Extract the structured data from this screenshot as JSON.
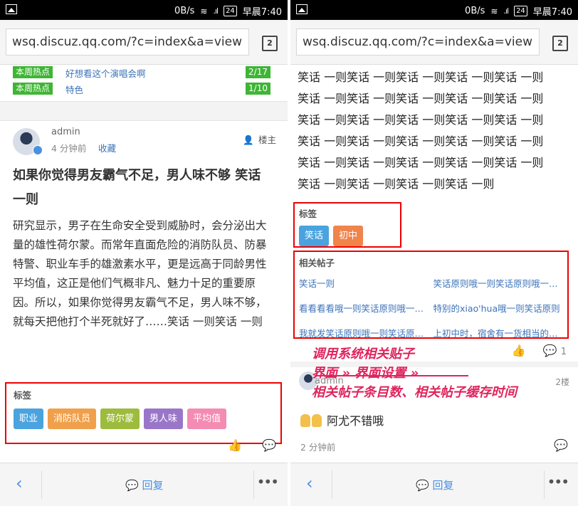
{
  "status": {
    "speed": "0B/s",
    "battery": "24",
    "time": "早晨7:40"
  },
  "browser": {
    "url": "wsq.discuz.qq.com/?c=index&a=view",
    "tab_count": "2"
  },
  "left": {
    "hot_items": [
      {
        "badge": "本周热点",
        "title": "好想看这个演唱会啊",
        "count": "2/17"
      },
      {
        "badge": "本周热点",
        "title": "特色",
        "count": "1/10"
      }
    ],
    "post": {
      "author": "admin",
      "time": "4 分钟前",
      "favorite": "收藏",
      "floor": "楼主",
      "title": "如果你觉得男友霸气不足，男人味不够 笑话 一则",
      "body": "研究显示，男子在生命安全受到威胁时，会分泌出大量的雄性荷尔蒙。而常年直面危险的消防队员、防暴特警、职业车手的雄激素水平，更是远高于同龄男性平均值，这正是他们气概非凡、魅力十足的重要原因。所以，如果你觉得男友霸气不足，男人味不够，就每天把他打个半死就好了……笑话 一则笑话 一则"
    },
    "tags_label": "标签",
    "tags": [
      {
        "label": "职业",
        "color": "#4aa3df"
      },
      {
        "label": "消防队员",
        "color": "#f0a04b"
      },
      {
        "label": "荷尔蒙",
        "color": "#9dbb3d"
      },
      {
        "label": "男人味",
        "color": "#9a76c9"
      },
      {
        "label": "平均值",
        "color": "#f48bb2"
      }
    ]
  },
  "right": {
    "joke_lines": [
      "笑话 一则笑话 一则笑话 一则笑话 一则笑话 一则",
      "笑话 一则笑话 一则笑话 一则笑话 一则笑话 一则",
      "笑话 一则笑话 一则笑话 一则笑话 一则笑话 一则",
      "笑话 一则笑话 一则笑话 一则笑话 一则笑话 一则",
      "笑话 一则笑话 一则笑话 一则笑话 一则笑话 一则",
      "笑话 一则笑话 一则笑话 一则笑话 一则"
    ],
    "tags_label": "标签",
    "tags": [
      {
        "label": "笑话",
        "color": "#4aa3df"
      },
      {
        "label": "初中",
        "color": "#f0844b"
      }
    ],
    "related_label": "相关帖子",
    "related": [
      "笑话一则",
      "笑话原则哦一则笑话原则哦一则笑话",
      "看看看看哦一则笑话原则哦一则笑话",
      "特别的xiao'hua哦一则笑话原则",
      "我就发笑话原则哦一则笑话原则哦",
      "上初中时，宿舍有一货相当的猥琐"
    ],
    "comment_count": "1",
    "annotation": [
      "调用系统相关贴子",
      "界面 » 界面设置 »",
      "相关帖子条目数、相关帖子缓存时间"
    ],
    "reply": {
      "author": "admin",
      "floor": "2楼",
      "text": "阿尤不错哦",
      "time": "2 分钟前"
    }
  },
  "bottom": {
    "reply_label": "回复"
  }
}
